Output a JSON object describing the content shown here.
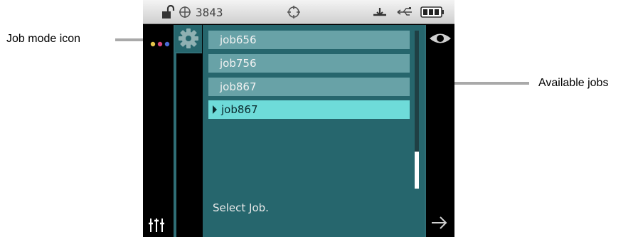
{
  "callouts": {
    "job_mode_icon": "Job mode icon",
    "available_jobs": "Available jobs"
  },
  "status_bar": {
    "icons": [
      "unlock-icon",
      "crosshair-icon",
      "target-icon",
      "scale-icon",
      "usb-icon",
      "battery-icon"
    ],
    "count": "3843"
  },
  "left_toolbar": {
    "icons": [
      "color-dots-icon",
      "sliders-icon"
    ],
    "dot_colors": [
      "#e6c64a",
      "#d9467d",
      "#4a6ad6"
    ]
  },
  "job_mode": {
    "icon": "gear-icon"
  },
  "jobs": [
    {
      "label": "job656",
      "selected": false
    },
    {
      "label": "job756",
      "selected": false
    },
    {
      "label": "job867",
      "selected": false
    },
    {
      "label": "job867",
      "selected": true
    }
  ],
  "hint": "Select Job.",
  "right_toolbar": {
    "icons": [
      "eye-icon",
      "arrow-right-icon"
    ]
  },
  "colors": {
    "panel": "#26666d",
    "item": "#68a2a7",
    "selected_item": "#6edbd9",
    "callout_arrow": "#a9a9a9"
  }
}
